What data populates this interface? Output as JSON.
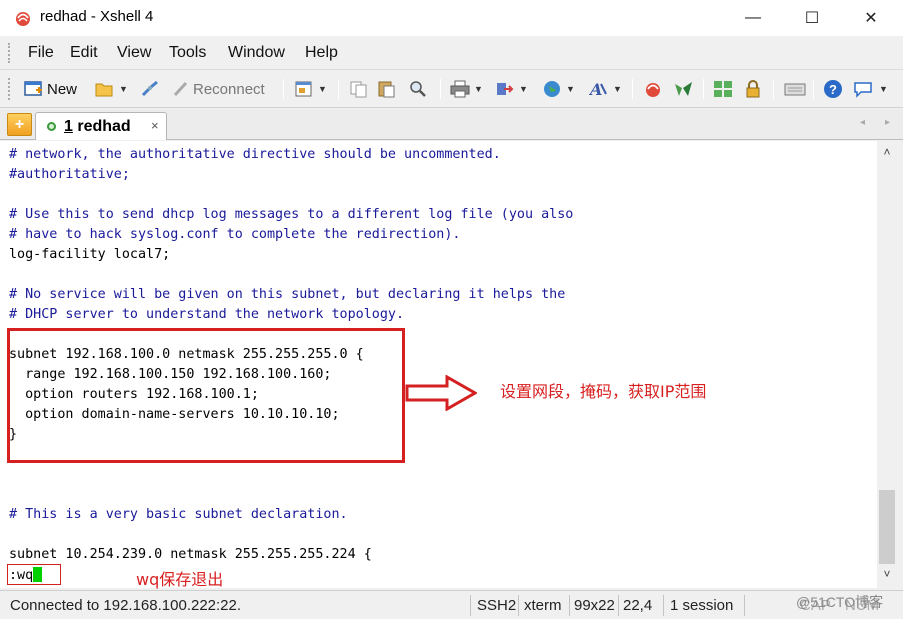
{
  "window": {
    "title": "redhad - Xshell 4",
    "controls": {
      "minimize": "—",
      "maximize": "☐",
      "close": "✕"
    }
  },
  "menubar": {
    "items": [
      "File",
      "Edit",
      "View",
      "Tools",
      "Window",
      "Help"
    ]
  },
  "toolbar": {
    "new_label": "New",
    "reconnect_label": "Reconnect",
    "icons": [
      "new-session-icon",
      "open-folder-icon",
      "link-icon",
      "reconnect-icon",
      "properties-icon",
      "copy-icon",
      "paste-icon",
      "find-icon",
      "print-icon",
      "transfer-icon",
      "globe-icon",
      "font-icon",
      "xshell-icon",
      "xftp-icon",
      "layout-icon",
      "lock-icon",
      "keyboard-icon",
      "help-icon",
      "chat-icon"
    ]
  },
  "tabs": {
    "add_label": "+",
    "active": {
      "number": "1",
      "name": "redhad",
      "close": "×"
    },
    "nav_left": "◂",
    "nav_right": "▸"
  },
  "terminal": {
    "lines": [
      "# network, the authoritative directive should be uncommented.",
      "#authoritative;",
      "",
      "# Use this to send dhcp log messages to a different log file (you also",
      "# have to hack syslog.conf to complete the redirection).",
      "log-facility local7;",
      "",
      "# No service will be given on this subnet, but declaring it helps the",
      "# DHCP server to understand the network topology.",
      "",
      "subnet 192.168.100.0 netmask 255.255.255.0 {",
      "  range 192.168.100.150 192.168.100.160;",
      "  option routers 192.168.100.1;",
      "  option domain-name-servers 10.10.10.10;",
      "}",
      "",
      "",
      "",
      "# This is a very basic subnet declaration.",
      "",
      "subnet 10.254.239.0 netmask 255.255.255.224 {"
    ],
    "command": ":wq"
  },
  "annotations": {
    "subnet_note": "设置网段，掩码，获取IP范围",
    "save_note": "wq保存退出",
    "color": "#d82020"
  },
  "scrollbar": {
    "up": "˄",
    "down": "˅"
  },
  "statusbar": {
    "connection": "Connected to 192.168.100.222:22.",
    "protocol": "SSH2",
    "terminal_type": "xterm",
    "size": "99x22",
    "cursor_pos": "22,4",
    "sessions": "1 session",
    "caps": "CAP",
    "num": "NUM"
  },
  "watermark": "@51CTO博客"
}
